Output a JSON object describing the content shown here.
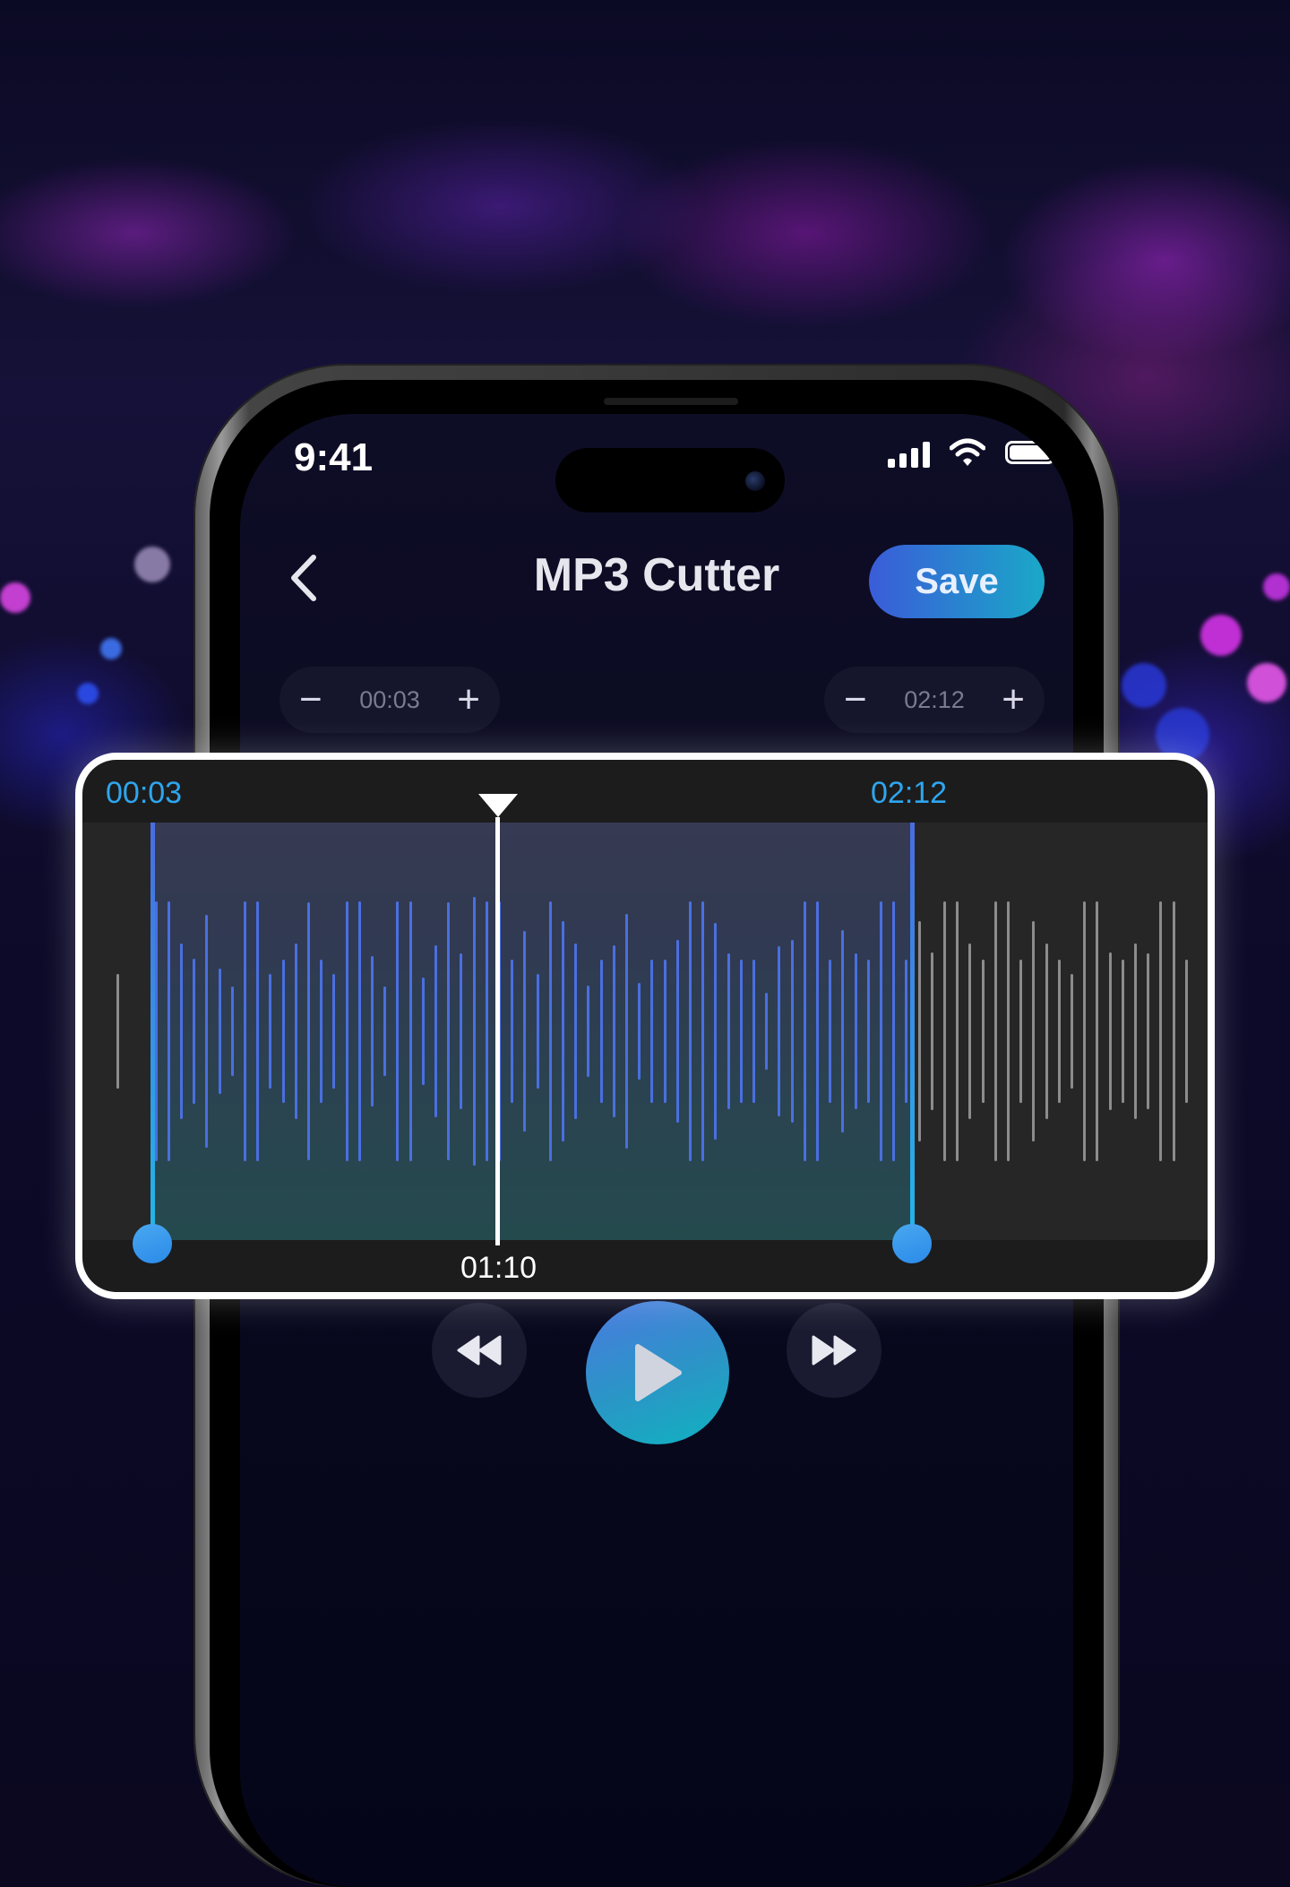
{
  "status_bar": {
    "time": "9:41"
  },
  "header": {
    "title": "MP3 Cutter",
    "save_label": "Save"
  },
  "start_stepper": {
    "minus": "−",
    "value": "00:03",
    "plus": "+"
  },
  "end_stepper": {
    "minus": "−",
    "value": "02:12",
    "plus": "+"
  },
  "waveform": {
    "start_time": "00:03",
    "end_time": "02:12",
    "playhead_time": "01:10",
    "selected_color": "#4a6fe0",
    "unselected_color": "#8c8c8c"
  },
  "icons": [
    "chevron-left-icon",
    "signal-icon",
    "wifi-icon",
    "battery-icon",
    "rewind-icon",
    "play-icon",
    "fast-forward-icon"
  ],
  "colors": {
    "accent_start": "#3a5cd8",
    "accent_end": "#1aa8c8",
    "time_blue": "#2ea6ef"
  }
}
